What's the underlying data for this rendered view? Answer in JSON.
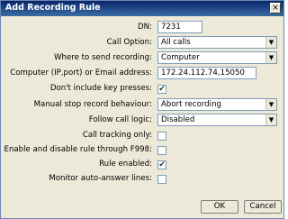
{
  "window": {
    "title": "Add Recording Rule",
    "close_glyph": "×"
  },
  "fields": {
    "dn": {
      "label": "DN:",
      "value": "7231"
    },
    "call_option": {
      "label": "Call Option:",
      "value": "All calls"
    },
    "where_to_send": {
      "label": "Where to send recording:",
      "value": "Computer"
    },
    "computer_or_email": {
      "label": "Computer (IP,port) or Email address:",
      "value": "172.24.112.74,15050"
    },
    "dont_include_keys": {
      "label": "Don't include key presses:",
      "checked": true
    },
    "manual_stop": {
      "label": "Manual stop record behaviour:",
      "value": "Abort recording"
    },
    "follow_call_logic": {
      "label": "Follow call logic:",
      "value": "Disabled"
    },
    "call_tracking_only": {
      "label": "Call tracking only:",
      "checked": false
    },
    "enable_disable_f998": {
      "label": "Enable and disable rule through F998:",
      "checked": false
    },
    "rule_enabled": {
      "label": "Rule enabled:",
      "checked": true
    },
    "monitor_auto_answer": {
      "label": "Monitor auto-answer lines:",
      "checked": false
    }
  },
  "buttons": {
    "ok": "OK",
    "cancel": "Cancel"
  },
  "glyphs": {
    "dropdown_arrow": "▼",
    "check_mark": "✔"
  }
}
